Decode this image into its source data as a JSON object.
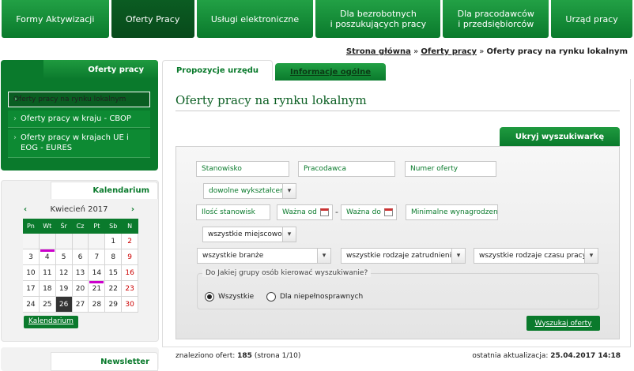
{
  "nav": {
    "tabs": [
      {
        "label": "Formy Aktywizacji"
      },
      {
        "label": "Oferty Pracy"
      },
      {
        "label": "Usługi elektroniczne"
      },
      {
        "label": "Dla bezrobotnych\ni poszukujących pracy"
      },
      {
        "label": "Dla pracodawców\ni przedsiębiorców"
      },
      {
        "label": "Urząd pracy"
      }
    ]
  },
  "breadcrumb": {
    "home": "Strona główna",
    "sep1": "»",
    "offers": "Oferty pracy",
    "sep2": "»",
    "current": "Oferty pracy na rynku lokalnym"
  },
  "sidebar": {
    "title": "Oferty pracy",
    "items": [
      {
        "label": "Oferty pracy na rynku lokalnym"
      },
      {
        "label": "Oferty pracy w kraju - CBOP"
      },
      {
        "label": "Oferty pracy w krajach UE i EOG - EURES"
      }
    ]
  },
  "calendar": {
    "title": "Kalendarium",
    "prev": "‹",
    "next": "›",
    "month": "Kwiecień 2017",
    "weekdays": [
      "Pn",
      "Wt",
      "Śr",
      "Cz",
      "Pt",
      "Sb",
      "N"
    ],
    "weeks": [
      [
        "",
        "",
        "",
        "",
        "",
        "1",
        "2"
      ],
      [
        "3",
        "4",
        "5",
        "6",
        "7",
        "8",
        "9"
      ],
      [
        "10",
        "11",
        "12",
        "13",
        "14",
        "15",
        "16"
      ],
      [
        "17",
        "18",
        "19",
        "20",
        "21",
        "22",
        "23"
      ],
      [
        "24",
        "25",
        "26",
        "27",
        "28",
        "29",
        "30"
      ]
    ],
    "button": "Kalendarium"
  },
  "newsletter": {
    "title": "Newsletter"
  },
  "tabs": {
    "active": "Propozycje urzędu",
    "other": "Informacje ogólne"
  },
  "page_title": "Oferty pracy na rynku lokalnym",
  "search": {
    "toggle": "Ukryj wyszukiwarkę",
    "stanowisko": "Stanowisko",
    "pracodawca": "Pracodawca",
    "numer": "Numer oferty",
    "wyksztalcenie": "dowolne wykształcenie",
    "ilosc": "Ilość stanowisk",
    "wazna_od": "Ważna od",
    "dash": "-",
    "wazna_do": "Ważna do",
    "wynagrodzenie": "Minimalne wynagrodzenie",
    "miejscowosci": "wszystkie miejscowości",
    "branze": "wszystkie branże",
    "zatrudnienie": "wszystkie rodzaje zatrudnienia",
    "czas_pracy": "wszystkie rodzaje czasu pracy",
    "group_legend": "Do Jakiej grupy osób kierować wyszukiwanie?",
    "radio_all": "Wszystkie",
    "radio_disabled": "Dla niepełnosprawnych",
    "button": "Wyszukaj oferty"
  },
  "results": {
    "found_label": "znaleziono ofert:",
    "found_count": "185",
    "found_page": "(strona 1/10)",
    "updated_label": "ostatnia aktualizacja:",
    "updated_value": "25.04.2017 14:18"
  },
  "colors": {
    "brand_green": "#0a7a2c",
    "dark_green": "#0a5e22"
  }
}
